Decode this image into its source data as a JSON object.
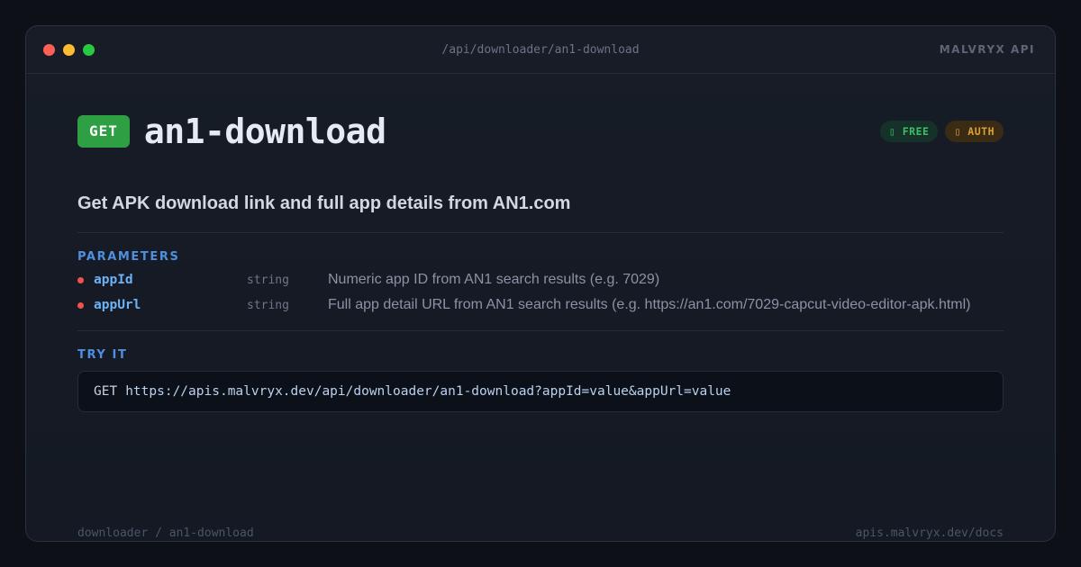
{
  "window": {
    "path": "/api/downloader/an1-download",
    "brand": "MALVRYX API"
  },
  "endpoint": {
    "method": "GET",
    "name": "an1-download",
    "badges": {
      "free": "▯ FREE",
      "auth": "▯ AUTH"
    },
    "description": "Get APK download link and full app details from AN1.com"
  },
  "parameters": {
    "label": "PARAMETERS",
    "items": [
      {
        "name": "appId",
        "type": "string",
        "description": "Numeric app ID from AN1 search results (e.g. 7029)",
        "required": true
      },
      {
        "name": "appUrl",
        "type": "string",
        "description": "Full app detail URL from AN1 search results (e.g. https://an1.com/7029-capcut-video-editor-apk.html)",
        "required": true
      }
    ]
  },
  "try_it": {
    "label": "TRY IT",
    "method": "GET",
    "url": "https://apis.malvryx.dev/api/downloader/an1-download?appId=value&appUrl=value"
  },
  "footer": {
    "breadcrumb": "downloader / an1-download",
    "docs": "apis.malvryx.dev/docs"
  },
  "colors": {
    "method_get": "#2ea043",
    "free_badge": "#3fbf68",
    "auth_badge": "#d9a033",
    "section_label": "#4f8fe0",
    "param_name": "#6cb2f5",
    "required_dot": "#f0524f"
  }
}
